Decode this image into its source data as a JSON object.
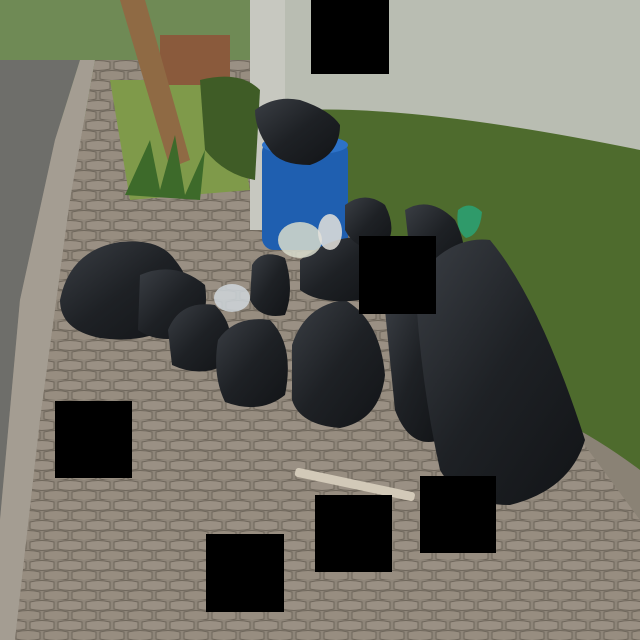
{
  "scene": {
    "subject": "garbage-bags-on-sidewalk",
    "colors": {
      "wall": "#b9bdb2",
      "pavement": "#8e8579",
      "hedge": "#4e6b2d",
      "bag": "#1f2226",
      "barrel": "#1f5fb0",
      "road": "#6e6e6a",
      "pole": "#8f6a44"
    }
  },
  "redactions": [
    {
      "id": "redaction-1"
    },
    {
      "id": "redaction-2"
    },
    {
      "id": "redaction-3"
    },
    {
      "id": "redaction-4"
    },
    {
      "id": "redaction-5"
    },
    {
      "id": "redaction-6"
    }
  ]
}
